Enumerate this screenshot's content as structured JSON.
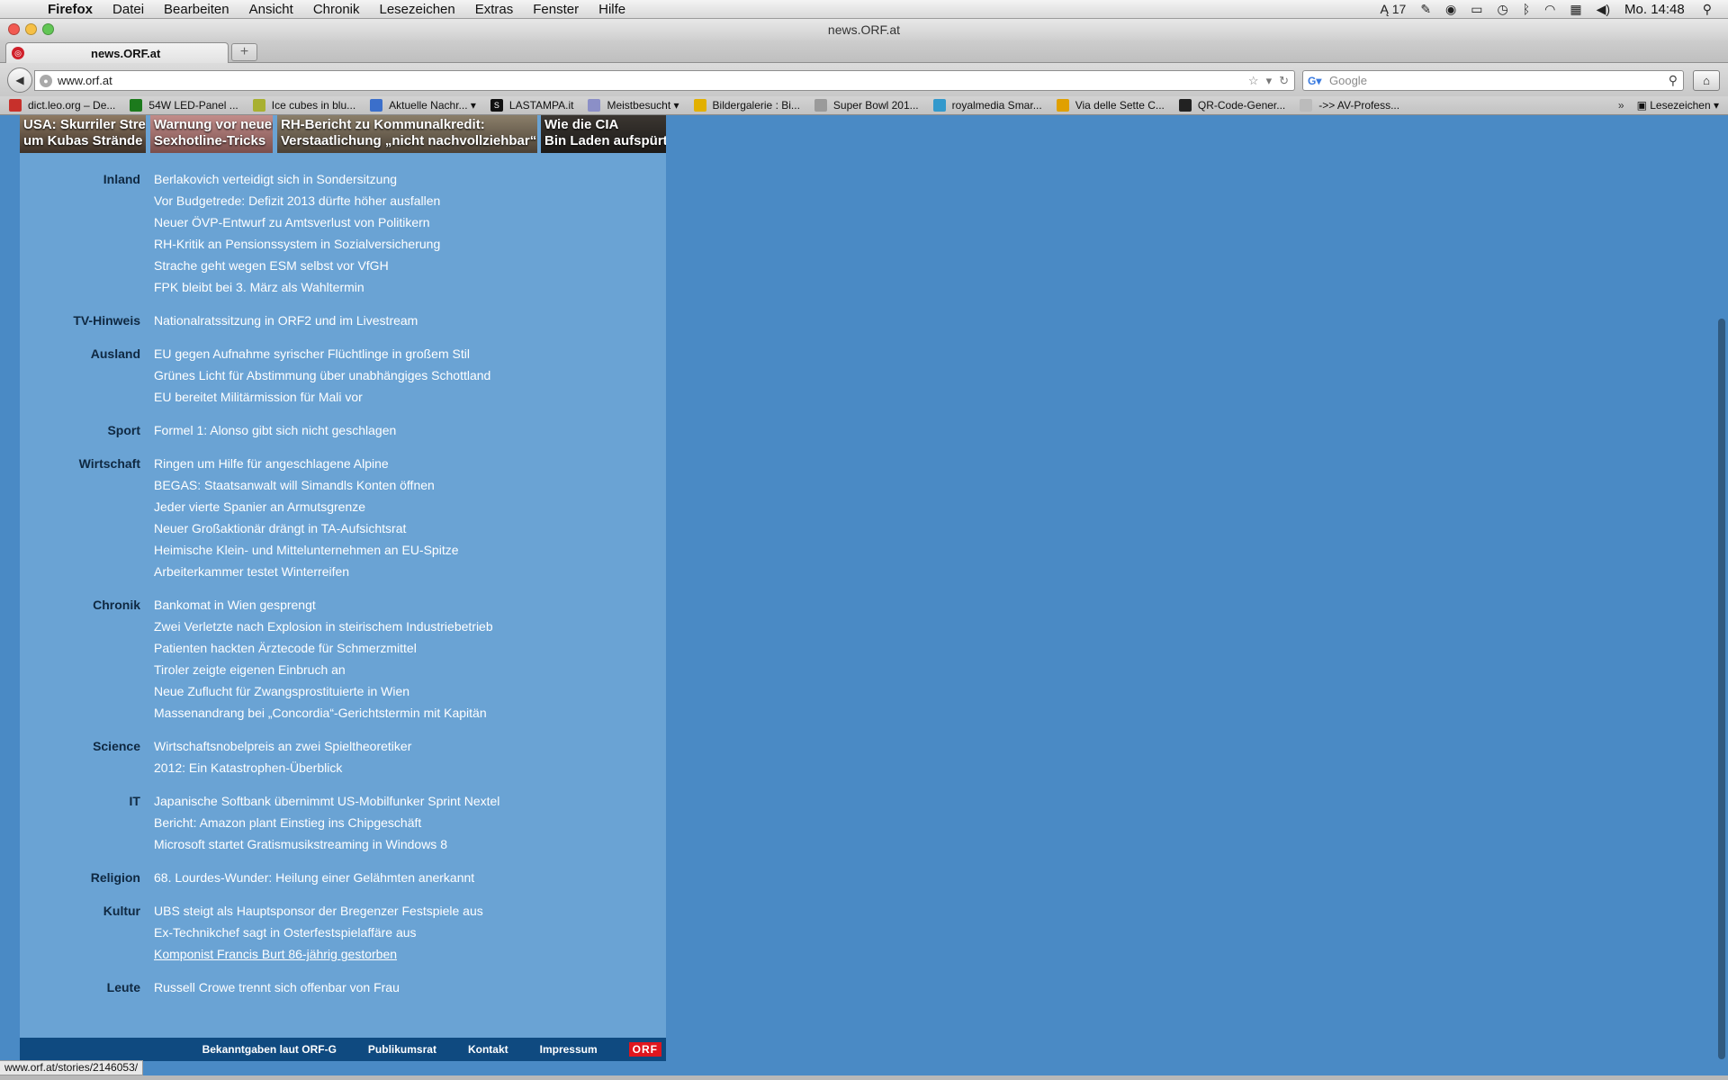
{
  "menubar": {
    "apple_glyph": "",
    "items": [
      "Firefox",
      "Datei",
      "Bearbeiten",
      "Ansicht",
      "Chronik",
      "Lesezeichen",
      "Extras",
      "Fenster",
      "Hilfe"
    ],
    "status": {
      "adobe_count": "17",
      "clock": "Mo. 14:48"
    }
  },
  "window": {
    "title": "news.ORF.at"
  },
  "tabs": {
    "active_tab_label": "news.ORF.at",
    "new_tab_label": "+"
  },
  "navbar": {
    "url": "www.orf.at",
    "search_placeholder": "Google"
  },
  "bookmarks": {
    "items": [
      {
        "label": "dict.leo.org – De...",
        "color": "#c7302b"
      },
      {
        "label": "54W LED-Panel ...",
        "color": "#1c7a1c"
      },
      {
        "label": "Ice cubes in blu...",
        "color": "#a8b030"
      },
      {
        "label": "Aktuelle Nachr...",
        "color": "#3b6fcb"
      },
      {
        "label": "LASTAMPA.it",
        "color": "#111111"
      },
      {
        "label": "Meistbesucht",
        "color": "#8b8fc7"
      },
      {
        "label": "Bildergalerie : Bi...",
        "color": "#e2b000"
      },
      {
        "label": "Super Bowl 201...",
        "color": "#9a9a9a"
      },
      {
        "label": "royalmedia Smar...",
        "color": "#3399cc"
      },
      {
        "label": "Via delle Sette C...",
        "color": "#e0a000"
      },
      {
        "label": "QR-Code-Gener...",
        "color": "#222222"
      },
      {
        "label": "->> AV-Profess...",
        "color": "#bbbbbb"
      }
    ],
    "overflow_chevron": "»",
    "lesezeichen_label": "Lesezeichen"
  },
  "teasers": [
    {
      "line1": "USA: Skurriler Streit",
      "line2": "um Kubas Strände"
    },
    {
      "line1": "Warnung vor neuen",
      "line2": "Sexhotline-Tricks"
    },
    {
      "line1": "RH-Bericht zu Kommunalkredit:",
      "line2": "Verstaatlichung „nicht nachvollziehbar“"
    },
    {
      "line1": "Wie die CIA",
      "line2": "Bin Laden aufspürte"
    }
  ],
  "sections": [
    {
      "label": "Inland",
      "items": [
        "Berlakovich verteidigt sich in Sondersitzung",
        "Vor Budgetrede: Defizit 2013 dürfte höher ausfallen",
        "Neuer ÖVP-Entwurf zu Amtsverlust von Politikern",
        "RH-Kritik an Pensionssystem in Sozialversicherung",
        "Strache geht wegen ESM selbst vor VfGH",
        "FPK bleibt bei 3. März als Wahltermin"
      ]
    },
    {
      "label": "TV-Hinweis",
      "items": [
        "Nationalratssitzung in ORF2 und im Livestream"
      ]
    },
    {
      "label": "Ausland",
      "items": [
        "EU gegen Aufnahme syrischer Flüchtlinge in großem Stil",
        "Grünes Licht für Abstimmung über unabhängiges Schottland",
        "EU bereitet Militärmission für Mali vor"
      ]
    },
    {
      "label": "Sport",
      "items": [
        "Formel 1: Alonso gibt sich nicht geschlagen"
      ]
    },
    {
      "label": "Wirtschaft",
      "items": [
        "Ringen um Hilfe für angeschlagene Alpine",
        "BEGAS: Staatsanwalt will Simandls Konten öffnen",
        "Jeder vierte Spanier an Armutsgrenze",
        "Neuer Großaktionär drängt in TA-Aufsichtsrat",
        "Heimische Klein- und Mittelunternehmen an EU-Spitze",
        "Arbeiterkammer testet Winterreifen"
      ]
    },
    {
      "label": "Chronik",
      "items": [
        "Bankomat in Wien gesprengt",
        "Zwei Verletzte nach Explosion in steirischem Industriebetrieb",
        "Patienten hackten Ärztecode für Schmerzmittel",
        "Tiroler zeigte eigenen Einbruch an",
        "Neue Zuflucht für Zwangsprostituierte in Wien",
        "Massenandrang bei „Concordia“-Gerichtstermin mit Kapitän"
      ]
    },
    {
      "label": "Science",
      "items": [
        "Wirtschaftsnobelpreis an zwei Spieltheoretiker",
        "2012: Ein Katastrophen-Überblick"
      ]
    },
    {
      "label": "IT",
      "items": [
        "Japanische Softbank übernimmt US-Mobilfunker Sprint Nextel",
        "Bericht: Amazon plant Einstieg ins Chipgeschäft",
        "Microsoft startet Gratismusikstreaming in Windows 8"
      ]
    },
    {
      "label": "Religion",
      "items": [
        "68. Lourdes-Wunder: Heilung einer Gelähmten anerkannt"
      ]
    },
    {
      "label": "Kultur",
      "items": [
        "UBS steigt als Hauptsponsor der Bregenzer Festspiele aus",
        "Ex-Technikchef sagt in Osterfestspielaffäre aus",
        "Komponist Francis Burt 86-jährig gestorben"
      ]
    },
    {
      "label": "Leute",
      "items": [
        "Russell Crowe trennt sich offenbar von Frau"
      ]
    }
  ],
  "hovered_link": "Komponist Francis Burt 86-jährig gestorben",
  "footer": {
    "links": [
      "Bekanntgaben laut ORF-G",
      "Publikumsrat",
      "Kontakt",
      "Impressum"
    ],
    "logo": "ORF"
  },
  "statusline": "www.orf.at/stories/2146053/",
  "colors": {
    "page_background": "#4a8ac5",
    "content_background": "#6aa3d4",
    "section_label": "#0f2841",
    "footer_background": "#0f4a80",
    "orf_red": "#e0161e"
  }
}
